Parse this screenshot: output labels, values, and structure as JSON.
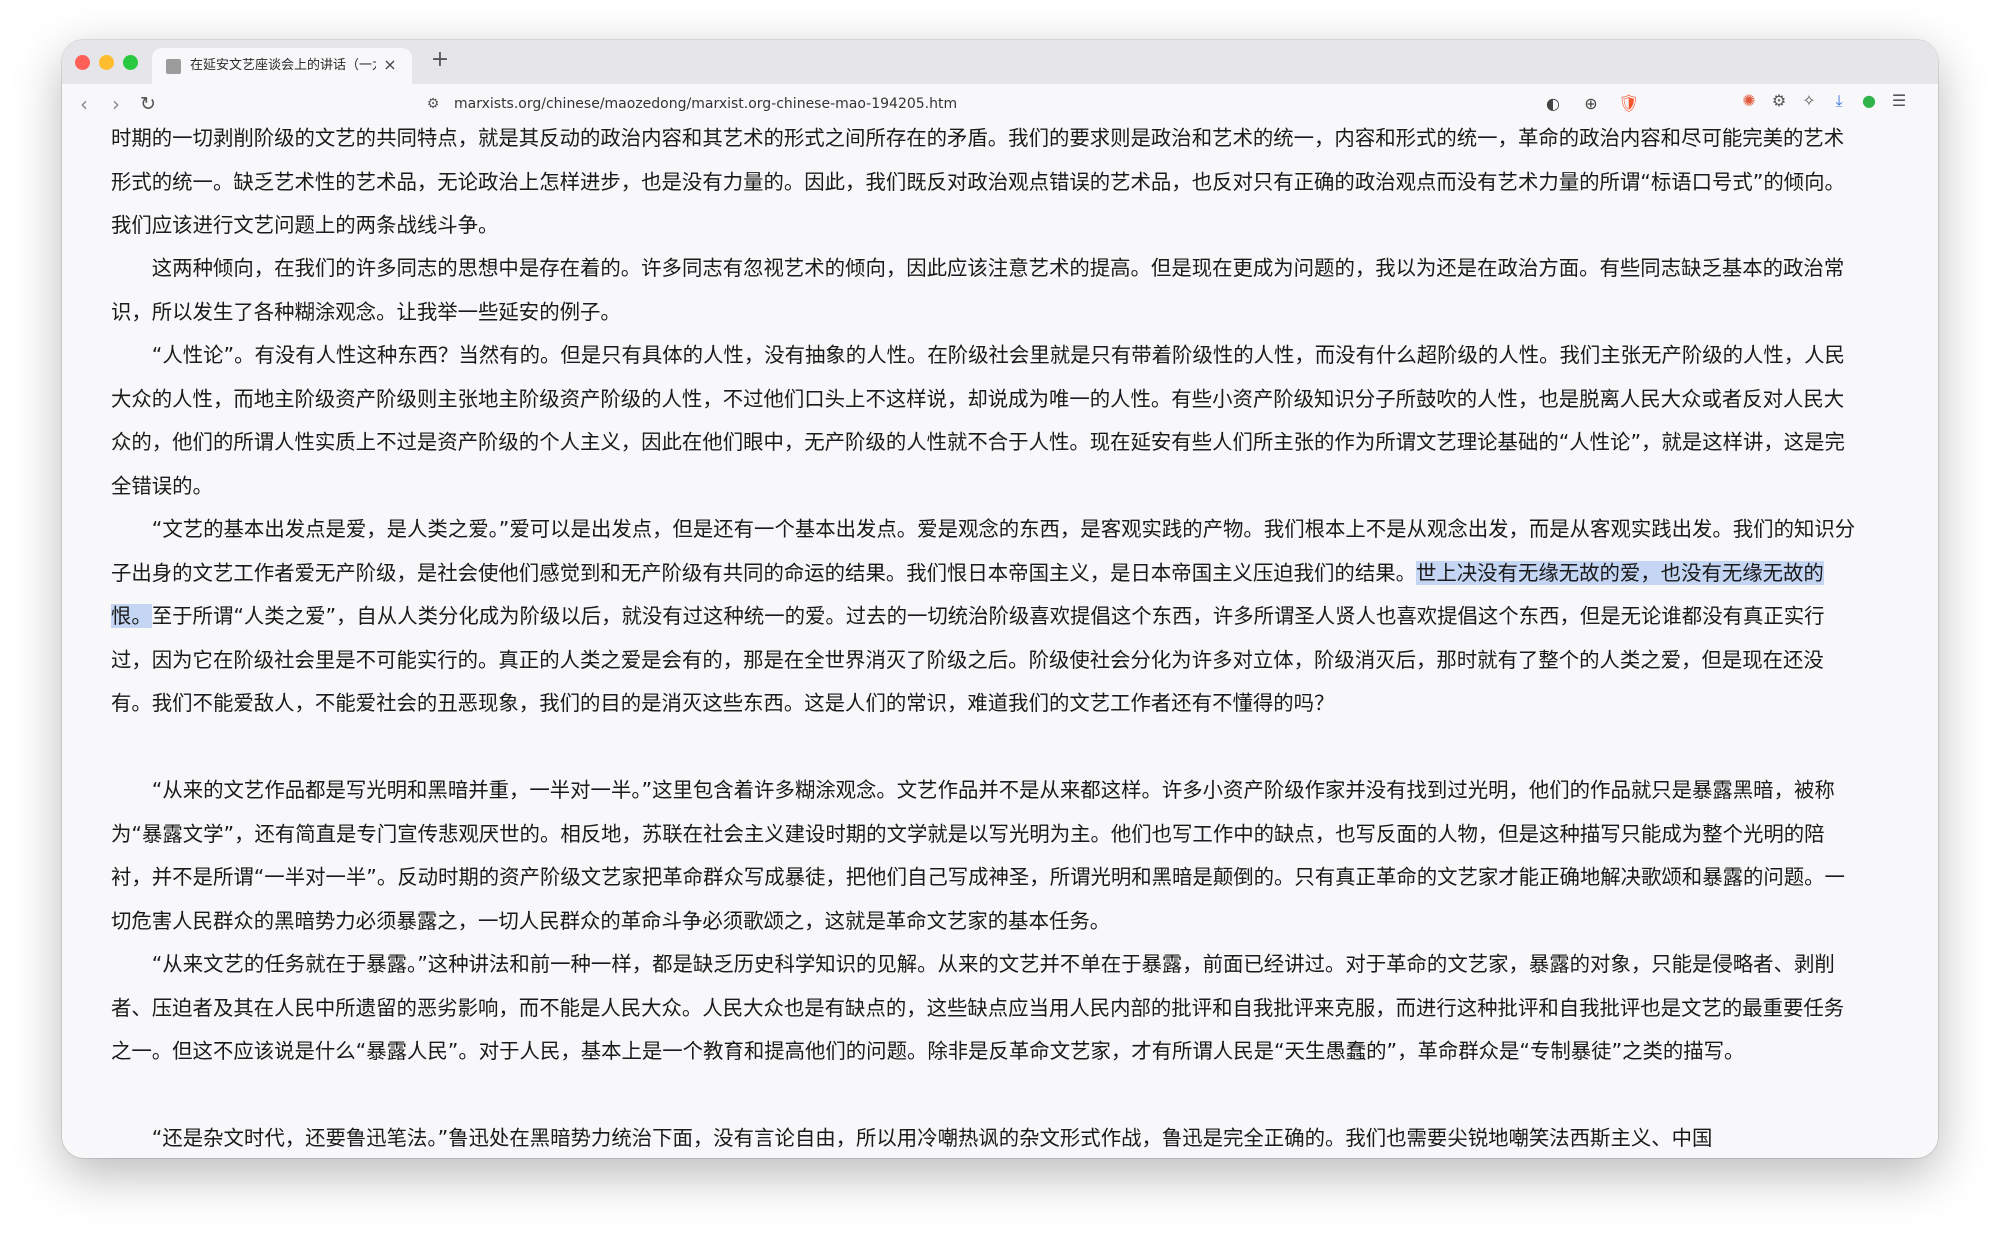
{
  "browser": {
    "tab": {
      "title": "在延安文艺座谈会上的讲话（一九四二年五月）",
      "close": "×"
    },
    "new_tab": "+",
    "nav": {
      "back": "‹",
      "forward": "›",
      "reload": "↻"
    },
    "url": "marxists.org/chinese/maozedong/marxist.org-chinese-mao-194205.htm"
  },
  "article": {
    "p1": "时期的一切剥削阶级的文艺的共同特点，就是其反动的政治内容和其艺术的形式之间所存在的矛盾。我们的要求则是政治和艺术的统一，内容和形式的统一，革命的政治内容和尽可能完美的艺术形式的统一。缺乏艺术性的艺术品，无论政治上怎样进步，也是没有力量的。因此，我们既反对政治观点错误的艺术品，也反对只有正确的政治观点而没有艺术力量的所谓“标语口号式”的倾向。我们应该进行文艺问题上的两条战线斗争。",
    "p2": "这两种倾向，在我们的许多同志的思想中是存在着的。许多同志有忽视艺术的倾向，因此应该注意艺术的提高。但是现在更成为问题的，我以为还是在政治方面。有些同志缺乏基本的政治常识，所以发生了各种糊涂观念。让我举一些延安的例子。",
    "p3": "“人性论”。有没有人性这种东西？当然有的。但是只有具体的人性，没有抽象的人性。在阶级社会里就是只有带着阶级性的人性，而没有什么超阶级的人性。我们主张无产阶级的人性，人民大众的人性，而地主阶级资产阶级则主张地主阶级资产阶级的人性，不过他们口头上不这样说，却说成为唯一的人性。有些小资产阶级知识分子所鼓吹的人性，也是脱离人民大众或者反对人民大众的，他们的所谓人性实质上不过是资产阶级的个人主义，因此在他们眼中，无产阶级的人性就不合于人性。现在延安有些人们所主张的作为所谓文艺理论基础的“人性论”，就是这样讲，这是完全错误的。",
    "p4_before": "“文艺的基本出发点是爱，是人类之爱。”爱可以是出发点，但是还有一个基本出发点。爱是观念的东西，是客观实践的产物。我们根本上不是从观念出发，而是从客观实践出发。我们的知识分子出身的文艺工作者爱无产阶级，是社会使他们感觉到和无产阶级有共同的命运的结果。我们恨日本帝国主义，是日本帝国主义压迫我们的结果。",
    "p4_highlight": "世上决没有无缘无故的爱，也没有无缘无故的恨。",
    "p4_after": "至于所谓“人类之爱”，自从人类分化成为阶级以后，就没有过这种统一的爱。过去的一切统治阶级喜欢提倡这个东西，许多所谓圣人贤人也喜欢提倡这个东西，但是无论谁都没有真正实行过，因为它在阶级社会里是不可能实行的。真正的人类之爱是会有的，那是在全世界消灭了阶级之后。阶级使社会分化为许多对立体，阶级消灭后，那时就有了整个的人类之爱，但是现在还没有。我们不能爱敌人，不能爱社会的丑恶现象，我们的目的是消灭这些东西。这是人们的常识，难道我们的文艺工作者还有不懂得的吗？",
    "p5": "“从来的文艺作品都是写光明和黑暗并重，一半对一半。”这里包含着许多糊涂观念。文艺作品并不是从来都这样。许多小资产阶级作家并没有找到过光明，他们的作品就只是暴露黑暗，被称为“暴露文学”，还有简直是专门宣传悲观厌世的。相反地，苏联在社会主义建设时期的文学就是以写光明为主。他们也写工作中的缺点，也写反面的人物，但是这种描写只能成为整个光明的陪衬，并不是所谓“一半对一半”。反动时期的资产阶级文艺家把革命群众写成暴徒，把他们自己写成神圣，所谓光明和黑暗是颠倒的。只有真正革命的文艺家才能正确地解决歌颂和暴露的问题。一切危害人民群众的黑暗势力必须暴露之，一切人民群众的革命斗争必须歌颂之，这就是革命文艺家的基本任务。",
    "p6": "“从来文艺的任务就在于暴露。”这种讲法和前一种一样，都是缺乏历史科学知识的见解。从来的文艺并不单在于暴露，前面已经讲过。对于革命的文艺家，暴露的对象，只能是侵略者、剥削者、压迫者及其在人民中所遗留的恶劣影响，而不能是人民大众。人民大众也是有缺点的，这些缺点应当用人民内部的批评和自我批评来克服，而进行这种批评和自我批评也是文艺的最重要任务之一。但这不应该说是什么“暴露人民”。对于人民，基本上是一个教育和提高他们的问题。除非是反革命文艺家，才有所谓人民是“天生愚蠢的”，革命群众是“专制暴徒”之类的描写。",
    "p7": "“还是杂文时代，还要鲁迅笔法。”鲁迅处在黑暗势力统治下面，没有言论自由，所以用冷嘲热讽的杂文形式作战，鲁迅是完全正确的。我们也需要尖锐地嘲笑法西斯主义、中国"
  }
}
